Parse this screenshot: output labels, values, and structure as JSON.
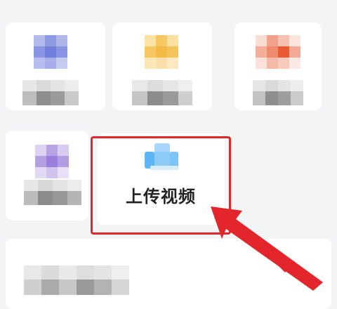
{
  "grid": {
    "cards": [
      {
        "id": "blurred-1"
      },
      {
        "id": "blurred-2"
      },
      {
        "id": "blurred-3"
      },
      {
        "id": "blurred-4"
      },
      {
        "id": "upload-video",
        "label": "上传视频",
        "icon": "upload-video-icon"
      }
    ]
  },
  "annotation": {
    "highlight_color": "#e3262b"
  }
}
